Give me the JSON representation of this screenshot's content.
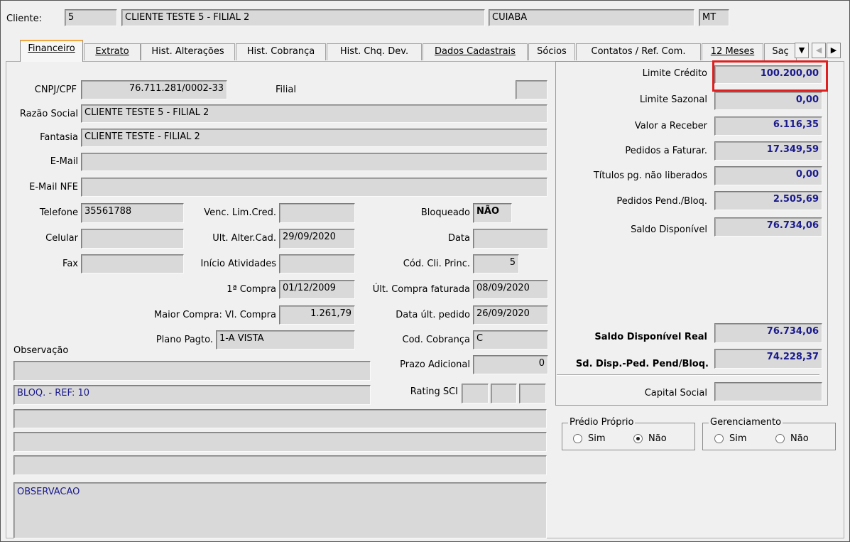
{
  "header": {
    "cliente_label": "Cliente:",
    "cliente_code": "5",
    "cliente_name": "CLIENTE TESTE 5  - FILIAL 2",
    "city": "CUIABA",
    "state": "MT"
  },
  "tabs": [
    {
      "label": "Financeiro"
    },
    {
      "label": "Extrato"
    },
    {
      "label": "Hist. Alterações"
    },
    {
      "label": "Hist. Cobrança"
    },
    {
      "label": "Hist. Chq. Dev."
    },
    {
      "label": "Dados Cadastrais"
    },
    {
      "label": "Sócios"
    },
    {
      "label": "Contatos / Ref. Com."
    },
    {
      "label": "12 Meses"
    },
    {
      "label": "Saç"
    }
  ],
  "form": {
    "cnpj_label": "CNPJ/CPF",
    "cnpj": "76.711.281/0002-33",
    "filial_label": "Filial",
    "filial": "",
    "razao_label": "Razão Social",
    "razao": "CLIENTE TESTE 5  - FILIAL 2",
    "fantasia_label": "Fantasia",
    "fantasia": "CLIENTE TESTE - FILIAL 2",
    "email_label": "E-Mail",
    "email": "",
    "email_nfe_label": "E-Mail NFE",
    "email_nfe": "",
    "telefone_label": "Telefone",
    "telefone": "35561788",
    "venc_label": "Venc. Lim.Cred.",
    "venc": "",
    "bloqueado_label": "Bloqueado",
    "bloqueado": "NÃO",
    "celular_label": "Celular",
    "celular": "",
    "ult_alter_label": "Ult. Alter.Cad.",
    "ult_alter": "29/09/2020",
    "data_label": "Data",
    "data": "",
    "fax_label": "Fax",
    "fax": "",
    "inicio_label": "Início Atividades",
    "inicio": "",
    "cod_cli_label": "Cód. Cli. Princ.",
    "cod_cli": "5",
    "primeira_compra_label": "1ª Compra",
    "primeira_compra": "01/12/2009",
    "ult_compra_label": "Últ. Compra faturada",
    "ult_compra": "08/09/2020",
    "maior_compra_label": "Maior Compra: Vl. Compra",
    "maior_compra": "1.261,79",
    "data_ult_pedido_label": "Data últ. pedido",
    "data_ult_pedido": "26/09/2020",
    "plano_label": "Plano Pagto.",
    "plano": "1-A VISTA",
    "cod_cobranca_label": "Cod. Cobrança",
    "cod_cobranca": "C",
    "observacao_label": "Observação",
    "prazo_label": "Prazo Adicional",
    "prazo": "0",
    "rating_label": "Rating SCI",
    "obs_line1": "",
    "obs_line2": "BLOQ. - REF: 10",
    "obs_line3": "",
    "obs_line4": "",
    "obs_line5": "",
    "obs_memo": "OBSERVACAO"
  },
  "credit": {
    "limite_credito_label": "Limite Crédito",
    "limite_credito": "100.200,00",
    "limite_sazonal_label": "Limite Sazonal",
    "limite_sazonal": "0,00",
    "valor_receber_label": "Valor a Receber",
    "valor_receber": "6.116,35",
    "pedidos_faturar_label": "Pedidos a Faturar.",
    "pedidos_faturar": "17.349,59",
    "titulos_label": "Títulos pg. não liberados",
    "titulos": "0,00",
    "pedidos_pend_label": "Pedidos Pend./Bloq.",
    "pedidos_pend": "2.505,69",
    "saldo_disp_label": "Saldo Disponível",
    "saldo_disp": "76.734,06",
    "saldo_real_label": "Saldo Disponível Real",
    "saldo_real": "76.734,06",
    "sd_disp_ped_label": "Sd. Disp.-Ped. Pend/Bloq.",
    "sd_disp_ped": "74.228,37",
    "capital_label": "Capital Social",
    "capital": ""
  },
  "predio": {
    "title": "Prédio Próprio",
    "sim": "Sim",
    "nao": "Não",
    "selected": "Não"
  },
  "gerenciamento": {
    "title": "Gerenciamento",
    "sim": "Sim",
    "nao": "Não",
    "selected": ""
  },
  "colors": {
    "highlight": "#e02020",
    "value_blue": "#1a1a8c",
    "active_tab_accent": "#f3a640"
  }
}
